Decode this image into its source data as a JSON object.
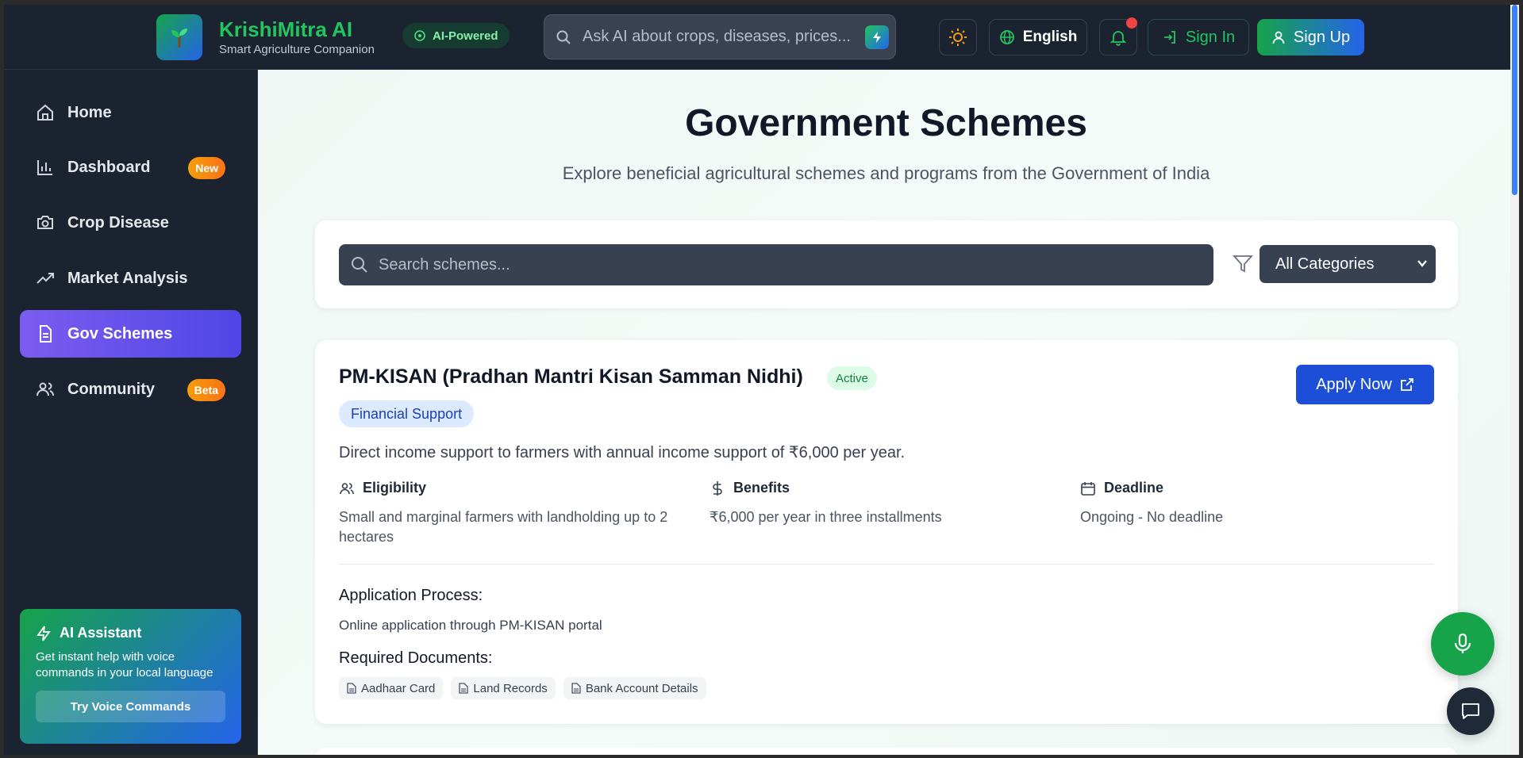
{
  "header": {
    "brand_name": "KrishiMitra AI",
    "brand_tagline": "Smart Agriculture Companion",
    "ai_badge": "AI-Powered",
    "search_placeholder": "Ask AI about crops, diseases, prices...",
    "language": "English",
    "sign_in": "Sign In",
    "sign_up": "Sign Up"
  },
  "sidebar": {
    "items": [
      {
        "label": "Home",
        "icon": "home-icon"
      },
      {
        "label": "Dashboard",
        "icon": "bar-chart-icon",
        "badge": "New"
      },
      {
        "label": "Crop Disease",
        "icon": "camera-icon"
      },
      {
        "label": "Market Analysis",
        "icon": "trending-up-icon"
      },
      {
        "label": "Gov Schemes",
        "icon": "document-icon",
        "active": true
      },
      {
        "label": "Community",
        "icon": "users-icon",
        "badge": "Beta"
      }
    ],
    "ai_card": {
      "title": "AI Assistant",
      "description": "Get instant help with voice commands in your local language",
      "button": "Try Voice Commands"
    }
  },
  "main": {
    "title": "Government Schemes",
    "subtitle": "Explore beneficial agricultural schemes and programs from the Government of India",
    "search_placeholder": "Search schemes...",
    "category_selected": "All Categories",
    "scheme": {
      "title": "PM-KISAN (Pradhan Mantri Kisan Samman Nidhi)",
      "status": "Active",
      "category": "Financial Support",
      "apply": "Apply Now",
      "description": "Direct income support to farmers with annual income support of ₹6,000 per year.",
      "eligibility_label": "Eligibility",
      "eligibility": "Small and marginal farmers with landholding up to 2 hectares",
      "benefits_label": "Benefits",
      "benefits": "₹6,000 per year in three installments",
      "deadline_label": "Deadline",
      "deadline": "Ongoing - No deadline",
      "process_label": "Application Process:",
      "process": "Online application through PM-KISAN portal",
      "docs_label": "Required Documents:",
      "documents": [
        "Aadhaar Card",
        "Land Records",
        "Bank Account Details"
      ]
    }
  },
  "colors": {
    "accent_green": "#16a34a",
    "accent_blue": "#2563eb",
    "active_nav": "#6d5ae6",
    "sidebar_bg": "#1c2330"
  }
}
